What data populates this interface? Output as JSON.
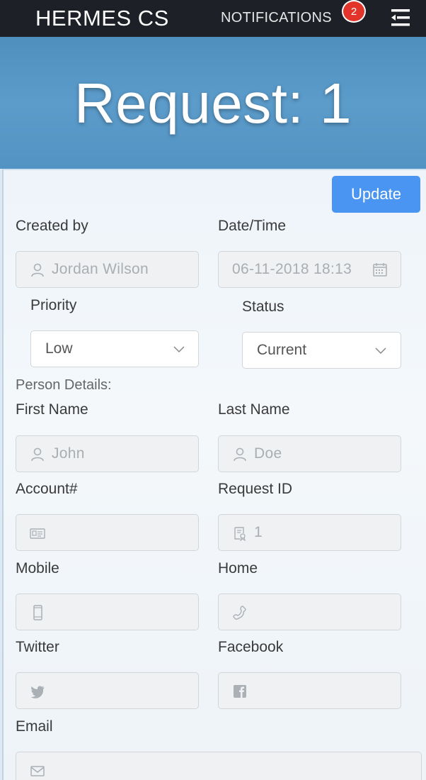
{
  "app": {
    "brand": "HERMES CS",
    "notifications_label": "NOTIFICATIONS",
    "notifications_count": "2"
  },
  "page": {
    "title": "Request: 1",
    "update_label": "Update"
  },
  "form": {
    "created_by_label": "Created by",
    "created_by_value": "Jordan Wilson",
    "datetime_label": "Date/Time",
    "datetime_value": "06-11-2018 18:13",
    "priority_label": "Priority",
    "priority_value": "Low",
    "status_label": "Status",
    "status_value": "Current",
    "person_details_label": "Person Details:",
    "first_name_label": "First Name",
    "first_name_value": "John",
    "last_name_label": "Last Name",
    "last_name_value": "Doe",
    "account_label": "Account#",
    "account_value": "",
    "request_id_label": "Request ID",
    "request_id_value": "1",
    "mobile_label": "Mobile",
    "mobile_value": "",
    "home_label": "Home",
    "home_value": "",
    "twitter_label": "Twitter",
    "twitter_value": "",
    "facebook_label": "Facebook",
    "facebook_value": "",
    "email_label": "Email",
    "email_value": ""
  },
  "icons": {
    "menu": "menu-collapse-icon",
    "user": "user-icon",
    "calendar": "calendar-icon",
    "chevron": "chevron-down-icon",
    "id_card": "id-card-icon",
    "badge": "id-badge-icon",
    "mobile": "mobile-phone-icon",
    "phone": "phone-icon",
    "twitter": "twitter-icon",
    "facebook": "facebook-icon",
    "email": "envelope-icon"
  },
  "colors": {
    "topbar": "#1d2127",
    "hero": "#5c9ccb",
    "accent": "#4a94f2",
    "badge": "#e2342b"
  }
}
